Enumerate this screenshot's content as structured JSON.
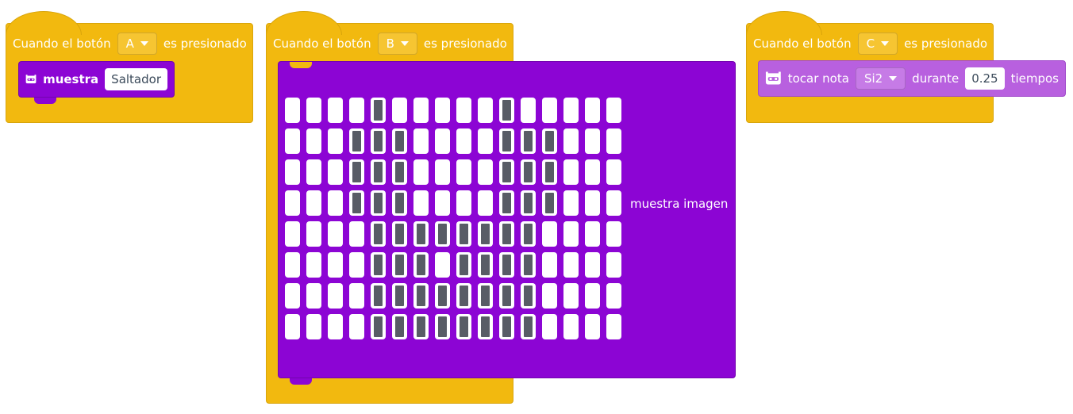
{
  "colors": {
    "event": "#F2B90F",
    "display": "#8C05D4",
    "sound": "#B860DF",
    "led_off": "#ffffff",
    "led_on": "#585c66"
  },
  "block_a": {
    "prefix": "Cuando el botón",
    "button": "A",
    "suffix": "es presionado",
    "statement": {
      "icon": "robot-icon",
      "label": "muestra",
      "value": "Saltador"
    }
  },
  "block_b": {
    "prefix": "Cuando el botón",
    "button": "B",
    "suffix": "es presionado",
    "statement": {
      "label": "muestra imagen",
      "matrix": {
        "rows": 8,
        "cols": 16,
        "pixels": [
          "0000100000100000",
          "0001110000111000",
          "0001110000111000",
          "0001110000111000",
          "0000111111110000",
          "0000111011110000",
          "0000111111110000",
          "0000111111110000"
        ]
      }
    }
  },
  "block_c": {
    "prefix": "Cuando el botón",
    "button": "C",
    "suffix": "es presionado",
    "statement": {
      "icon": "robot-icon",
      "label": "tocar nota",
      "note": "Si2",
      "mid": "durante",
      "beats": "0.25",
      "unit": "tiempos"
    }
  }
}
